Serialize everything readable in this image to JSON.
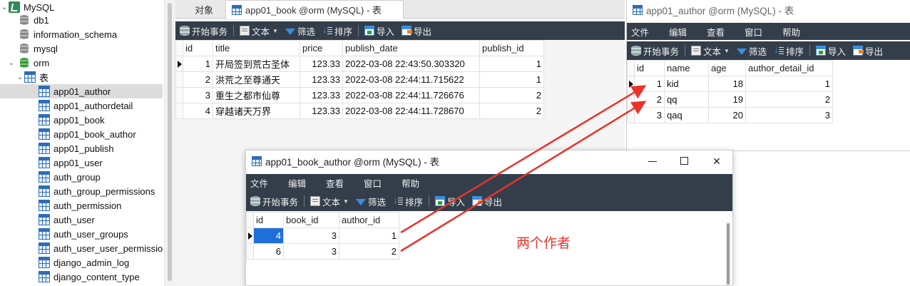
{
  "tree": {
    "connection": "MySQL",
    "databases": [
      "db1",
      "information_schema",
      "mysql",
      "orm"
    ],
    "tables_folder": "表",
    "tables": [
      "app01_author",
      "app01_authordetail",
      "app01_book",
      "app01_book_author",
      "app01_publish",
      "app01_user",
      "auth_group",
      "auth_group_permissions",
      "auth_permission",
      "auth_user",
      "auth_user_groups",
      "auth_user_user_permissio",
      "django_admin_log",
      "django_content_type"
    ],
    "selected_table": "app01_author"
  },
  "toolbar": {
    "begin_transaction": "开始事务",
    "text": "文本",
    "filter": "筛选",
    "sort": "排序",
    "import": "导入",
    "export": "导出"
  },
  "menu": {
    "file": "文件",
    "edit": "编辑",
    "view": "查看",
    "window": "窗口",
    "help": "帮助"
  },
  "main": {
    "tab_objects": "对象",
    "tab_book": "app01_book @orm (MySQL) - 表",
    "book_table": {
      "columns": [
        "id",
        "title",
        "price",
        "publish_date",
        "publish_id"
      ],
      "rows": [
        [
          "1",
          "开局签到荒古圣体",
          "123.33",
          "2022-03-08 22:43:50.303320",
          "1"
        ],
        [
          "2",
          "洪荒之至尊通天",
          "123.33",
          "2022-03-08 22:44:11.715622",
          "1"
        ],
        [
          "3",
          "重生之都市仙尊",
          "123.33",
          "2022-03-08 22:44:11.726676",
          "2"
        ],
        [
          "4",
          "穿越诸天万界",
          "123.33",
          "2022-03-08 22:44:11.728670",
          "2"
        ]
      ]
    }
  },
  "author_window": {
    "title": "app01_author @orm (MySQL) - 表",
    "table": {
      "columns": [
        "id",
        "name",
        "age",
        "author_detail_id"
      ],
      "rows": [
        [
          "1",
          "kid",
          "18",
          "1"
        ],
        [
          "2",
          "qq",
          "19",
          "2"
        ],
        [
          "3",
          "qaq",
          "20",
          "3"
        ]
      ]
    }
  },
  "book_author_window": {
    "title": "app01_book_author @orm (MySQL) - 表",
    "minimize": "—",
    "close": "✕",
    "table": {
      "columns": [
        "id",
        "book_id",
        "author_id"
      ],
      "rows": [
        [
          "4",
          "3",
          "1"
        ],
        [
          "6",
          "3",
          "2"
        ]
      ]
    }
  },
  "annotation": {
    "text": "两个作者",
    "color": "#e8332a"
  },
  "colors": {
    "toolbar_bg": "#333e4a",
    "selection": "#1e6fd9",
    "db_active": "#3f9a3f"
  }
}
